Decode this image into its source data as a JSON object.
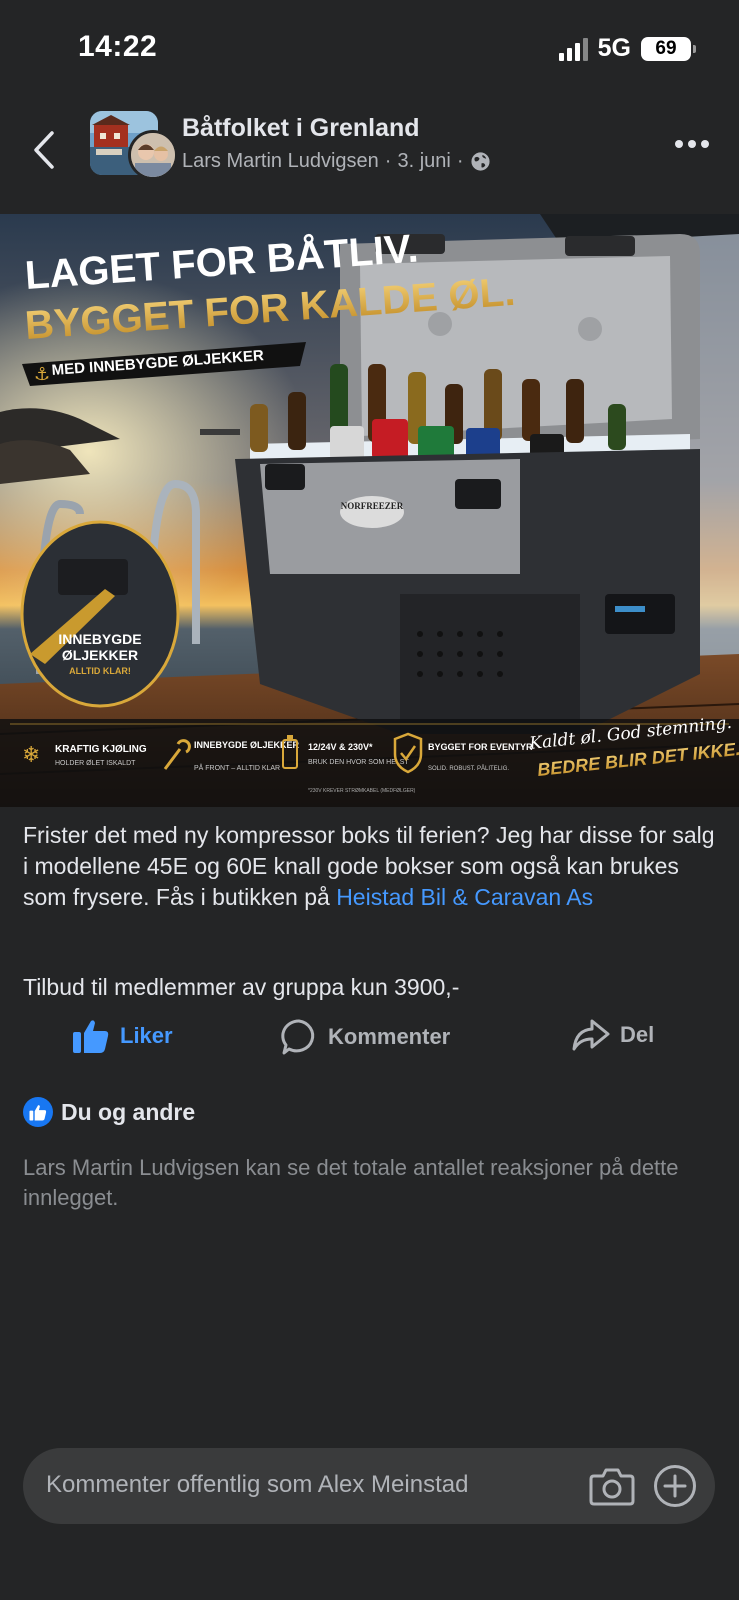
{
  "status_bar": {
    "time": "14:22",
    "network": "5G",
    "battery": "69"
  },
  "header": {
    "group_name": "Båtfolket i Grenland",
    "author": "Lars Martin Ludvigsen",
    "date": "3. juni",
    "separator": "·",
    "privacy_icon": "globe-icon"
  },
  "ad_image": {
    "headline_line1": "LAGET FOR BÅTLIV.",
    "headline_line2": "BYGGET FOR KALDE ØL.",
    "ribbon": "MED INNEBYGDE ØLJEKKER",
    "badge_line1": "INNEBYGDE",
    "badge_line2": "ØLJEKKER",
    "badge_sub": "ALLTID KLAR!",
    "brand": "NORFREEZER",
    "features": [
      {
        "title": "KRAFTIG KJØLING",
        "sub": "HOLDER ØLET ISKALDT",
        "icon": "snowflake-icon"
      },
      {
        "title": "INNEBYGDE ØLJEKKER",
        "sub": "PÅ FRONT – ALLTID KLAR",
        "icon": "bottle-opener-icon"
      },
      {
        "title": "12/24V & 230V*",
        "sub": "BRUK DEN HVOR SOM HELST",
        "note": "*230V KREVER STRØMKABEL (MEDFØLGER)",
        "icon": "battery-icon"
      },
      {
        "title": "BYGGET FOR EVENTYR",
        "sub": "SOLID. ROBUST. PÅLITELIG.",
        "icon": "shield-icon"
      }
    ],
    "slogan_line1": "Kaldt øl. God stemning.",
    "slogan_line2": "BEDRE BLIR DET IKKE."
  },
  "post": {
    "text": "Frister det med ny kompressor boks til ferien?  Jeg har disse for salg i modellene 45E og 60E knall gode bokser som også kan brukes som frysere. Fås i butikken på ",
    "link_text": "Heistad Bil & Caravan As",
    "offer": "Tilbud til medlemmer av gruppa kun 3900,-"
  },
  "actions": {
    "like": "Liker",
    "comment": "Kommenter",
    "share": "Del"
  },
  "reactions": {
    "label": "Du og andre",
    "note": "Lars Martin Ludvigsen kan se det totale antallet reaksjoner på dette innlegget."
  },
  "comment_bar": {
    "placeholder": "Kommenter offentlig som Alex Meinstad"
  },
  "colors": {
    "background": "#242526",
    "accent": "#4599ff",
    "muted": "#b0b3b8",
    "gold": "#d9a83a"
  }
}
